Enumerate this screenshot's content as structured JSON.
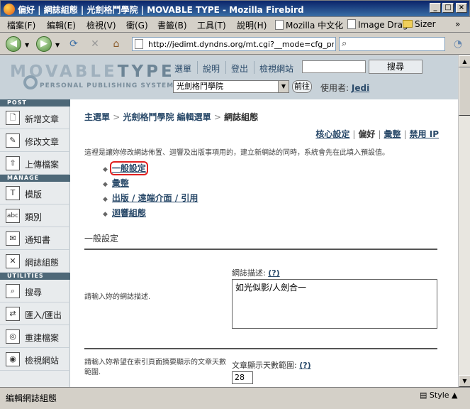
{
  "window": {
    "title": "偏好 | 網誌組態 | 光劍格鬥學院 | MOVABLE TYPE - Mozilla Firebird",
    "minimize": "_",
    "maximize": "□",
    "close": "×"
  },
  "menu": {
    "items": [
      "檔案(F)",
      "編輯(E)",
      "檢視(V)",
      "衝(G)",
      "書籤(B)",
      "工具(T)",
      "說明(H)"
    ],
    "bookmarks": [
      "Mozilla 中文化",
      "Image Drag",
      "Sizer"
    ],
    "overflow": "»"
  },
  "nav": {
    "url": "http://jedimt.dyndns.org/mt.cgi?__mode=cfg_prefs&",
    "search_placeholder": ""
  },
  "mt": {
    "logo_movable": "MOVABLE",
    "logo_type": "TYPE",
    "tagline": "PERSONAL PUBLISHING SYSTEM",
    "top_links": [
      "選單",
      "說明",
      "登出",
      "檢視網站"
    ],
    "search_button": "搜尋",
    "blog_select": "光劍格鬥學院",
    "go_button": "前往",
    "user_label": "使用者:",
    "user_name": "Jedi"
  },
  "sidebar": {
    "sections": [
      "POST",
      "MANAGE",
      "UTILITIES"
    ],
    "post_items": [
      {
        "label": "新增文章",
        "icon": "new-entry-icon",
        "glyph": "🗋"
      },
      {
        "label": "修改文章",
        "icon": "edit-entry-icon",
        "glyph": "✎"
      },
      {
        "label": "上傳檔案",
        "icon": "upload-icon",
        "glyph": "⇧"
      }
    ],
    "manage_items": [
      {
        "label": "模版",
        "icon": "template-icon",
        "glyph": "T"
      },
      {
        "label": "類別",
        "icon": "category-icon",
        "glyph": "abc"
      },
      {
        "label": "通知書",
        "icon": "notification-icon",
        "glyph": "✉"
      },
      {
        "label": "網誌組態",
        "icon": "tools-icon",
        "glyph": "✕"
      }
    ],
    "utility_items": [
      {
        "label": "搜尋",
        "icon": "search-icon",
        "glyph": "⌕"
      },
      {
        "label": "匯入/匯出",
        "icon": "import-export-icon",
        "glyph": "⇄"
      },
      {
        "label": "重建檔案",
        "icon": "rebuild-icon",
        "glyph": "◎"
      },
      {
        "label": "檢視網站",
        "icon": "view-site-icon",
        "glyph": "◉"
      }
    ]
  },
  "main": {
    "breadcrumb": [
      "主選單",
      "光劍格鬥學院 編輯選單",
      "網誌組態"
    ],
    "bc_sep": ">",
    "subtabs": {
      "core": "核心設定",
      "prefs": "偏好",
      "archive": "彙整",
      "ip_ban": "禁用 IP"
    },
    "intro": "這裡是讓妳修改網誌佈置、迴響及出版事項用的，建立新網誌的同時，系統會先在此填入預設值。",
    "cfg_links": [
      "一般設定",
      "彙整",
      "出版 / 遠端介面 / 引用",
      "迴響組態"
    ],
    "section_general": "一般設定",
    "desc_label": "網誌描述:",
    "help": "(?)",
    "desc_prompt": "請輸入妳的網誌描述.",
    "desc_value": "如光似影/人劍合一",
    "days_label": "文章顯示天數範圍:",
    "days_prompt": "請輸入妳希望在索引頁面摘要顯示的文章天數範圍.",
    "days_value": "28"
  },
  "status": {
    "text": "編輯網誌組態",
    "style": "Style"
  }
}
